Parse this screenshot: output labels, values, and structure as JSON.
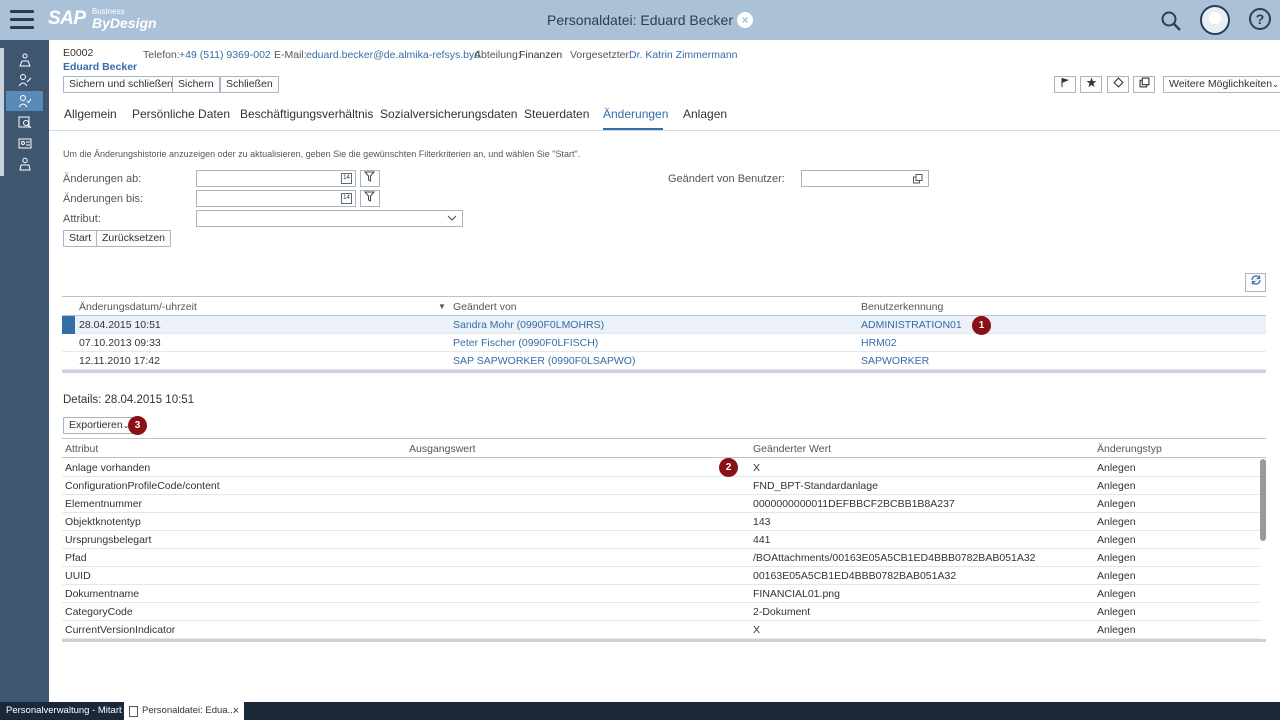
{
  "shell": {
    "logo_sap": "SAP",
    "logo_business": "Business",
    "logo_bydesign": "ByDesign",
    "title": "Personaldatei: Eduard Becker",
    "close": "×",
    "help": "?"
  },
  "nav": {
    "items": [
      "org-chart-icon",
      "people-edit-icon",
      "people-check-icon",
      "calendar-search-icon",
      "id-card-icon",
      "people-group-icon"
    ]
  },
  "header": {
    "id": "E0002",
    "name": "Eduard Becker",
    "phone_label": "Telefon:",
    "phone": "+49 (511) 9369-002",
    "email_label": "E-Mail:",
    "email": "eduard.becker@de.almika-refsys.byd",
    "dept_label": "Abteilung:",
    "dept": "Finanzen",
    "manager_label": "Vorgesetzter:",
    "manager": "Dr. Katrin Zimmermann"
  },
  "toolbar": {
    "save_close": "Sichern und schließen",
    "save": "Sichern",
    "close": "Schließen",
    "more": "Weitere Möglichkeiten"
  },
  "tabs": [
    "Allgemein",
    "Persönliche Daten",
    "Beschäftigungsverhältnis",
    "Sozialversicherungsdaten",
    "Steuerdaten",
    "Änderungen",
    "Anlagen"
  ],
  "filter": {
    "hint": "Um die Änderungshistorie anzuzeigen oder zu aktualisieren, geben Sie die gewünschten Filterkriterien an, und wählen Sie \"Start\".",
    "from_label": "Änderungen ab:",
    "to_label": "Änderungen bis:",
    "attr_label": "Attribut:",
    "user_label": "Geändert von Benutzer:",
    "start": "Start",
    "reset": "Zurücksetzen"
  },
  "changes": {
    "headers": [
      "Änderungsdatum/-uhrzeit",
      "Geändert von",
      "Benutzerkennung"
    ],
    "rows": [
      {
        "date": "28.04.2015 10:51",
        "by": "Sandra Mohr (0990F0LMOHRS)",
        "user": "ADMINISTRATION01"
      },
      {
        "date": "07.10.2013 09:33",
        "by": "Peter Fischer (0990F0LFISCH)",
        "user": "HRM02"
      },
      {
        "date": "12.11.2010 17:42",
        "by": "SAP SAPWORKER (0990F0LSAPWO)",
        "user": "SAPWORKER"
      }
    ]
  },
  "details": {
    "title": "Details: 28.04.2015 10:51",
    "export": "Exportieren",
    "headers": [
      "Attribut",
      "Ausgangswert",
      "Geänderter Wert",
      "Änderungstyp"
    ],
    "rows": [
      {
        "attr": "Anlage vorhanden",
        "old": "",
        "new": "X",
        "type": "Anlegen"
      },
      {
        "attr": "ConfigurationProfileCode/content",
        "old": "",
        "new": "FND_BPT-Standardanlage",
        "type": "Anlegen"
      },
      {
        "attr": "Elementnummer",
        "old": "",
        "new": "0000000000011DEFBBCF2BCBB1B8A237",
        "type": "Anlegen"
      },
      {
        "attr": "Objektknotentyp",
        "old": "",
        "new": "143",
        "type": "Anlegen"
      },
      {
        "attr": "Ursprungsbelegart",
        "old": "",
        "new": "441",
        "type": "Anlegen"
      },
      {
        "attr": "Pfad",
        "old": "",
        "new": "/BOAttachments/00163E05A5CB1ED4BBB0782BAB051A32",
        "type": "Anlegen"
      },
      {
        "attr": "UUID",
        "old": "",
        "new": "00163E05A5CB1ED4BBB0782BAB051A32",
        "type": "Anlegen"
      },
      {
        "attr": "Dokumentname",
        "old": "",
        "new": "FINANCIAL01.png",
        "type": "Anlegen"
      },
      {
        "attr": "CategoryCode",
        "old": "",
        "new": "2-Dokument",
        "type": "Anlegen"
      },
      {
        "attr": "CurrentVersionIndicator",
        "old": "",
        "new": "X",
        "type": "Anlegen"
      }
    ]
  },
  "badges": {
    "one": "1",
    "two": "2",
    "three": "3"
  },
  "taskbar": {
    "task1": "Personalverwaltung - Mitarb...",
    "task2": "Personaldatei: Edua...",
    "task2_close": "×"
  }
}
